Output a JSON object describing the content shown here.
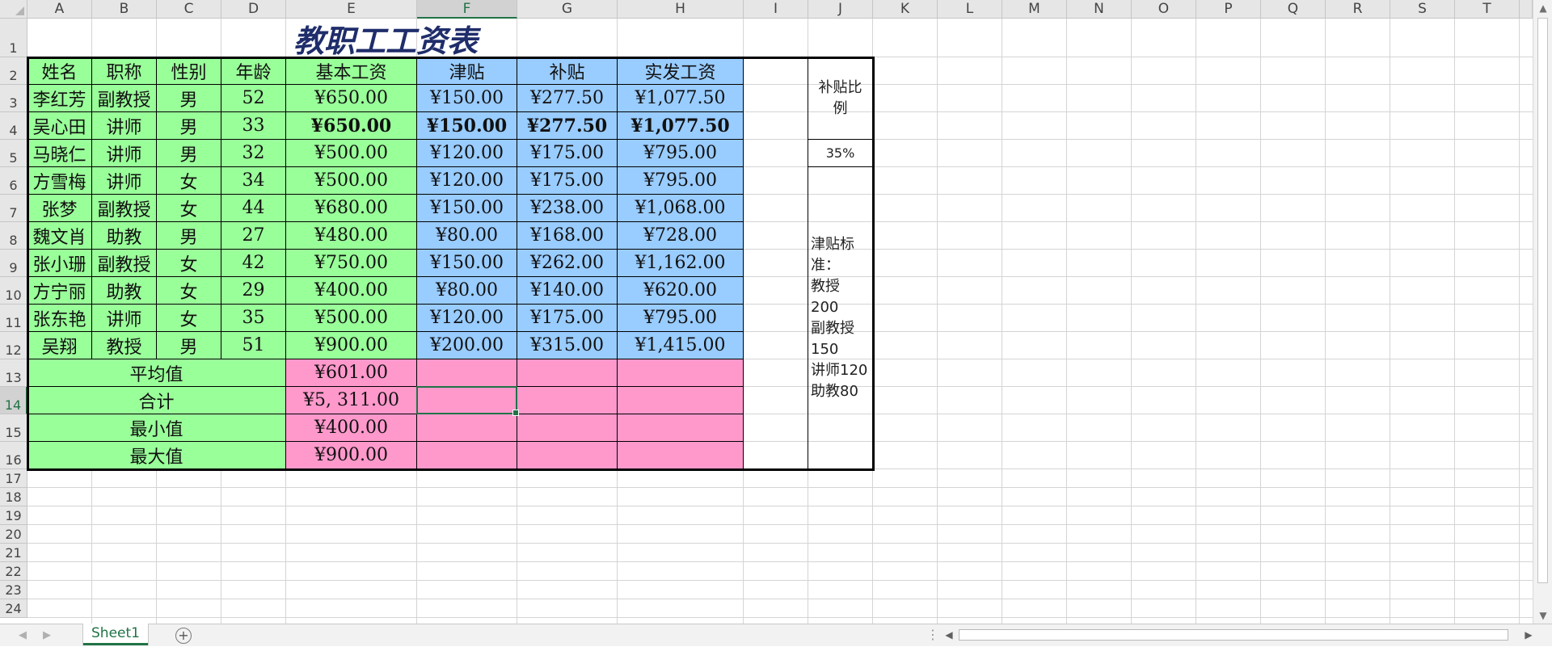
{
  "columns": [
    "A",
    "B",
    "C",
    "D",
    "E",
    "F",
    "G",
    "H",
    "I",
    "J",
    "K",
    "L",
    "M",
    "N",
    "O",
    "P",
    "Q",
    "R",
    "S",
    "T"
  ],
  "rows": [
    "1",
    "2",
    "3",
    "4",
    "5",
    "6",
    "7",
    "8",
    "9",
    "10",
    "11",
    "12",
    "13",
    "14",
    "15",
    "16",
    "17",
    "18",
    "19",
    "20",
    "21",
    "22",
    "23",
    "24"
  ],
  "selected": {
    "column": "F",
    "row": "14"
  },
  "title": "教职工工资表",
  "headers": [
    "姓名",
    "职称",
    "性别",
    "年龄",
    "基本工资",
    "津贴",
    "补贴",
    "实发工资"
  ],
  "employees": [
    [
      "李红芳",
      "副教授",
      "男",
      "52",
      "¥650.00",
      "¥150.00",
      "¥277.50",
      "¥1,077.50"
    ],
    [
      "吴心田",
      "讲师",
      "男",
      "33",
      "¥650.00",
      "¥150.00",
      "¥277.50",
      "¥1,077.50"
    ],
    [
      "马晓仁",
      "讲师",
      "男",
      "32",
      "¥500.00",
      "¥120.00",
      "¥175.00",
      "¥795.00"
    ],
    [
      "方雪梅",
      "讲师",
      "女",
      "34",
      "¥500.00",
      "¥120.00",
      "¥175.00",
      "¥795.00"
    ],
    [
      "张梦",
      "副教授",
      "女",
      "44",
      "¥680.00",
      "¥150.00",
      "¥238.00",
      "¥1,068.00"
    ],
    [
      "魏文肖",
      "助教",
      "男",
      "27",
      "¥480.00",
      "¥80.00",
      "¥168.00",
      "¥728.00"
    ],
    [
      "张小珊",
      "副教授",
      "女",
      "42",
      "¥750.00",
      "¥150.00",
      "¥262.00",
      "¥1,162.00"
    ],
    [
      "方宁丽",
      "助教",
      "女",
      "29",
      "¥400.00",
      "¥80.00",
      "¥140.00",
      "¥620.00"
    ],
    [
      "张东艳",
      "讲师",
      "女",
      "35",
      "¥500.00",
      "¥120.00",
      "¥175.00",
      "¥795.00"
    ],
    [
      "吴翔",
      "教授",
      "男",
      "51",
      "¥900.00",
      "¥200.00",
      "¥315.00",
      "¥1,415.00"
    ]
  ],
  "summary": [
    {
      "label": "平均值",
      "value": "¥601.00"
    },
    {
      "label": "合计",
      "value": "¥5, 311.00"
    },
    {
      "label": "最小值",
      "value": "¥400.00"
    },
    {
      "label": "最大值",
      "value": "¥900.00"
    }
  ],
  "side": {
    "ratio_label": "补贴比例",
    "ratio_value": "35%",
    "note_lines": [
      "津贴标",
      "准：",
      "教授",
      "200",
      "副教授",
      "150",
      "讲师120",
      "助教80"
    ]
  },
  "sheet_tab": "Sheet1",
  "icons": {
    "add_sheet": "plus-circle-icon"
  }
}
